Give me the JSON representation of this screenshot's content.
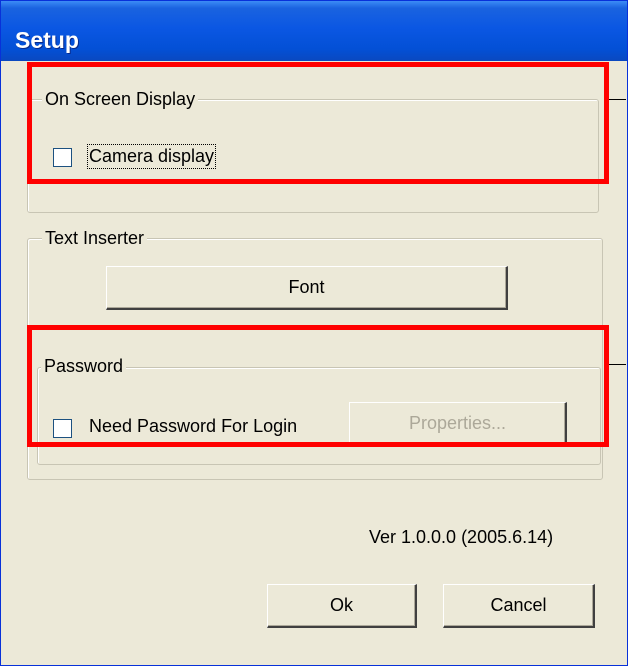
{
  "window": {
    "title": "Setup"
  },
  "osd": {
    "group_label": "On Screen Display",
    "camera_display_label": "Camera display",
    "camera_display_checked": false
  },
  "text_inserter": {
    "group_label": "Text Inserter",
    "font_button": "Font"
  },
  "password": {
    "group_label": "Password",
    "need_password_label": "Need Password For Login",
    "need_password_checked": false,
    "properties_button": "Properties..."
  },
  "version": "Ver 1.0.0.0 (2005.6.14)",
  "buttons": {
    "ok": "Ok",
    "cancel": "Cancel"
  },
  "colors": {
    "dialog_bg": "#ece9d8",
    "titlebar": "#0350d6",
    "highlight": "#ff0000",
    "disabled_text": "#aca899"
  }
}
